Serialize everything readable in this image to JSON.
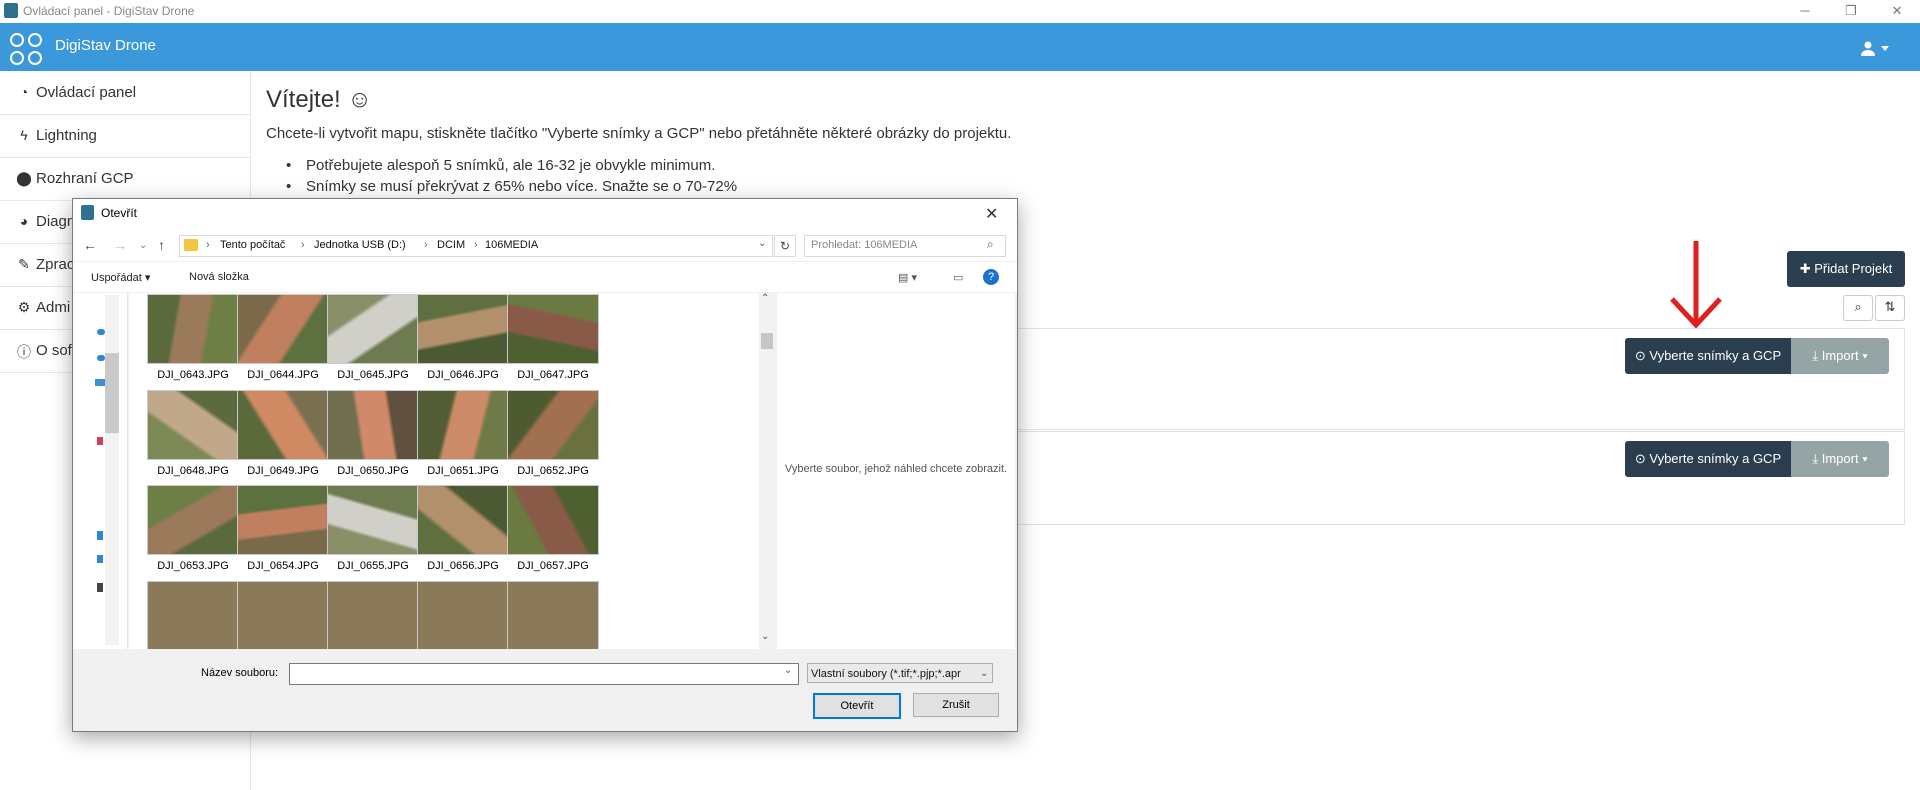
{
  "window": {
    "title": "Ovládací panel - DigiStav Drone",
    "controls": [
      "─",
      "❐",
      "✕"
    ]
  },
  "header": {
    "app_name": "DigiStav Drone",
    "user_icon": "user-icon"
  },
  "sidebar": {
    "items": [
      {
        "label": "Ovládací panel",
        "icon": "dashboard-icon"
      },
      {
        "label": "Lightning",
        "icon": "bolt-icon"
      },
      {
        "label": "Rozhraní GCP",
        "icon": "map-marker-icon"
      },
      {
        "label": "Diagn",
        "icon": "pie-chart-icon"
      },
      {
        "label": "Zprac",
        "icon": "wrench-icon"
      },
      {
        "label": "Admi",
        "icon": "gears-icon"
      },
      {
        "label": "O sof",
        "icon": "info-icon"
      }
    ]
  },
  "main": {
    "welcome": "Vítejte! ☺",
    "intro": "Chcete-li vytvořit mapu, stiskněte tlačítko \"Vyberte snímky a GCP\" nebo přetáhněte některé obrázky do projektu.",
    "bullets": [
      "Potřebujete alespoň 5 snímků, ale 16-32 je obvykle minimum.",
      "Snímky se musí překrývat z 65% nebo více. Snažte se o 70-72%"
    ],
    "add_project": "✚ Přidat Projekt",
    "projects": [
      {
        "upload_label": "Vyberte snímky a GCP",
        "import_label": "Import"
      },
      {
        "upload_label": "Vyberte snímky a GCP",
        "import_label": "Import"
      }
    ]
  },
  "dialog": {
    "title": "Otevřít",
    "breadcrumb": [
      "Tento počítač",
      "Jednotka USB (D:)",
      "DCIM",
      "106MEDIA"
    ],
    "search_placeholder": "Prohledat: 106MEDIA",
    "organize": "Uspořádat",
    "new_folder": "Nová složka",
    "files": [
      "DJI_0643.JPG",
      "DJI_0644.JPG",
      "DJI_0645.JPG",
      "DJI_0646.JPG",
      "DJI_0647.JPG",
      "DJI_0648.JPG",
      "DJI_0649.JPG",
      "DJI_0650.JPG",
      "DJI_0651.JPG",
      "DJI_0652.JPG",
      "DJI_0653.JPG",
      "DJI_0654.JPG",
      "DJI_0655.JPG",
      "DJI_0656.JPG",
      "DJI_0657.JPG"
    ],
    "preview_text": "Vyberte soubor, jehož náhled chcete zobrazit.",
    "filename_label": "Název souboru:",
    "filename_value": "",
    "filetype": "Vlastní soubory (*.tif;*.pjp;*.apr",
    "open_button": "Otevřít",
    "cancel_button": "Zrušit"
  },
  "colors": {
    "header_bg": "#3b98da",
    "button_dark": "#2b3e50",
    "button_gray": "#95a5a6",
    "arrow": "#e02020"
  }
}
